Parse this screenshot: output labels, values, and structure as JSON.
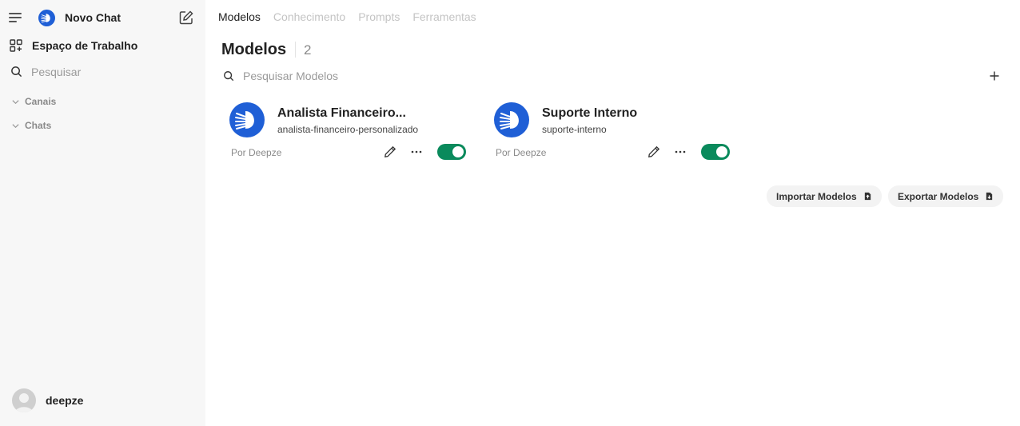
{
  "sidebar": {
    "new_chat": "Novo Chat",
    "workspace": "Espaço de Trabalho",
    "search": "Pesquisar",
    "sections": [
      "Canais",
      "Chats"
    ],
    "username": "deepze",
    "icons": [
      "menu-icon",
      "logo-icon",
      "edit-icon",
      "grid-icon",
      "search-icon",
      "chevron-down-icon",
      "avatar-icon"
    ]
  },
  "main": {
    "tabs": [
      "Modelos",
      "Conhecimento",
      "Prompts",
      "Ferramentas"
    ],
    "active_tab": "Modelos",
    "title": "Modelos",
    "count": "2",
    "search_placeholder": "Pesquisar Modelos",
    "models": [
      {
        "name": "Analista Financeiro...",
        "id": "analista-financeiro-personalizado",
        "by": "Por Deepze",
        "enabled": true
      },
      {
        "name": "Suporte Interno",
        "id": "suporte-interno",
        "by": "Por Deepze",
        "enabled": true
      }
    ],
    "import_label": "Importar Modelos",
    "export_label": "Exportar Modelos"
  },
  "colors": {
    "accent": "#0a8a5c",
    "logo": "#1f5fd6",
    "sidebar_bg": "#f7f7f7"
  }
}
